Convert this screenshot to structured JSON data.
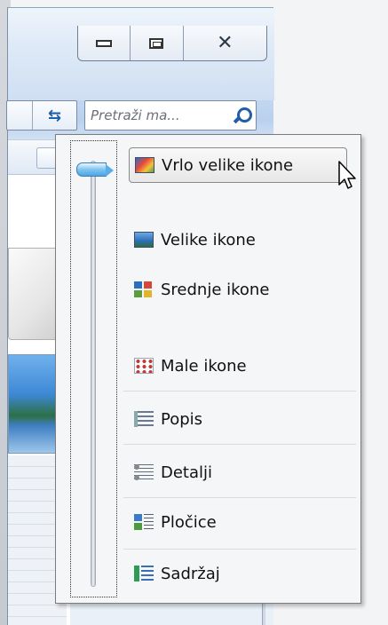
{
  "window": {
    "search": {
      "placeholder": "Pretraži ma..."
    }
  },
  "view_menu": {
    "items": [
      {
        "label": "Vrlo velike ikone",
        "icon": "extra-large-icons-icon",
        "selected": true
      },
      {
        "label": "Velike ikone",
        "icon": "large-icons-icon"
      },
      {
        "label": "Srednje ikone",
        "icon": "medium-icons-icon"
      },
      {
        "label": "Male ikone",
        "icon": "small-icons-icon"
      },
      {
        "label": "Popis",
        "icon": "list-icon"
      },
      {
        "label": "Detalji",
        "icon": "details-icon"
      },
      {
        "label": "Pločice",
        "icon": "tiles-icon"
      },
      {
        "label": "Sadržaj",
        "icon": "content-icon"
      }
    ]
  },
  "colors": {
    "accent": "#4aa6e4",
    "menu_bg": "#f5f6f7"
  }
}
